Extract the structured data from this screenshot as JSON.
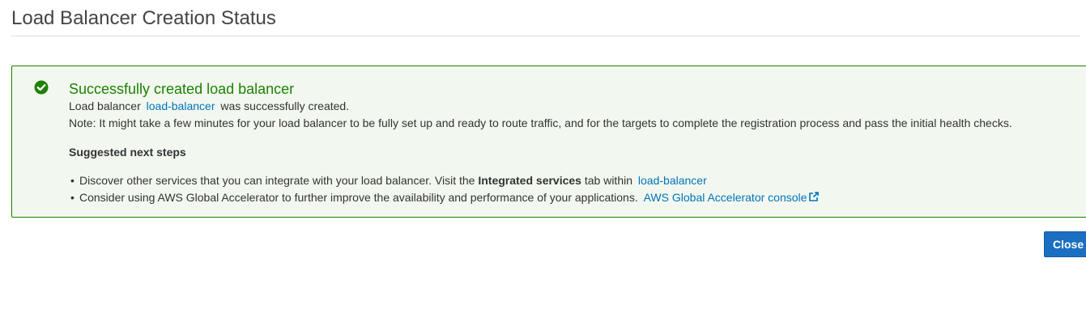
{
  "page": {
    "title": "Load Balancer Creation Status"
  },
  "alert": {
    "status_icon": "check-circle-icon",
    "heading": "Successfully created load balancer",
    "line1_prefix": "Load balancer",
    "line1_link": "load-balancer",
    "line1_suffix": "was successfully created.",
    "note": "Note: It might take a few minutes for your load balancer to be fully set up and ready to route traffic, and for the targets to complete the registration process and pass the initial health checks.",
    "next_steps_title": "Suggested next steps",
    "steps": [
      {
        "text_before": "Discover other services that you can integrate with your load balancer. Visit the",
        "bold": "Integrated services",
        "text_after": "tab within",
        "link": "load-balancer"
      },
      {
        "text_before": "Consider using AWS Global Accelerator to further improve the availability and performance of your applications.",
        "link": "AWS Global Accelerator console",
        "link_icon": "external-link-icon"
      }
    ]
  },
  "actions": {
    "close_label": "Close"
  },
  "colors": {
    "success_green": "#1d8102",
    "success_bg": "#f2f8f0",
    "link_blue": "#0073bb",
    "primary_button": "#1a6fc2"
  }
}
